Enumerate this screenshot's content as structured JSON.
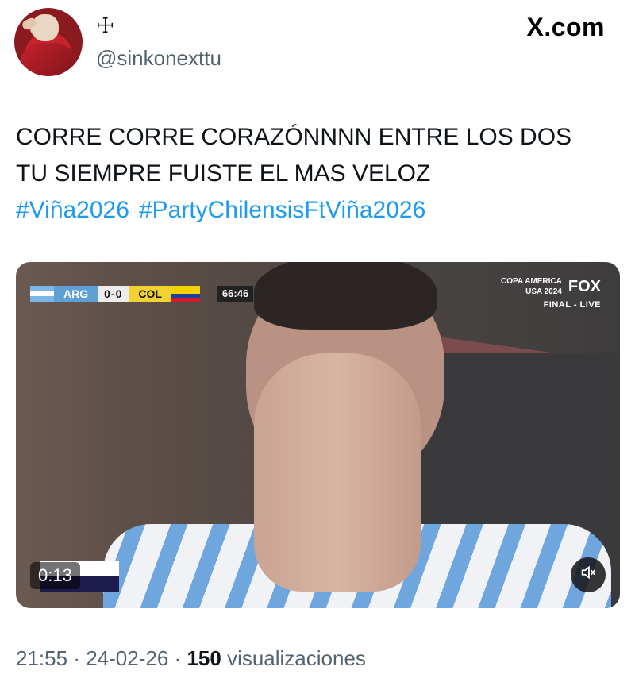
{
  "author": {
    "display_name": "☩",
    "handle": "@sinkonexttu",
    "avatar_icon": "avatar-photo"
  },
  "brand": "X.com",
  "tweet": {
    "lines": [
      "CORRE CORRE CORAZÓNNNN ENTRE LOS DOS",
      "TU SIEMPRE FUISTE EL MAS VELOZ"
    ],
    "hashtags": [
      "#Viña2026",
      "#PartyChilensisFtViña2026"
    ]
  },
  "video": {
    "scoreboard": {
      "team1": "ARG",
      "score": "0-0",
      "team2": "COL",
      "clock": "66:46"
    },
    "broadcast": {
      "title": "COPA AMERICA",
      "subtitle": "USA 2024",
      "network": "FOX",
      "status": "FINAL - LIVE"
    },
    "duration": "0:13",
    "mute_icon": "speaker-muted-icon"
  },
  "meta": {
    "time": "21:55",
    "date": "24-02-26",
    "views_count": "150",
    "views_label": "visualizaciones"
  },
  "colors": {
    "link": "#1d9bf0",
    "secondary_text": "#536471",
    "primary_text": "#0f1419"
  }
}
